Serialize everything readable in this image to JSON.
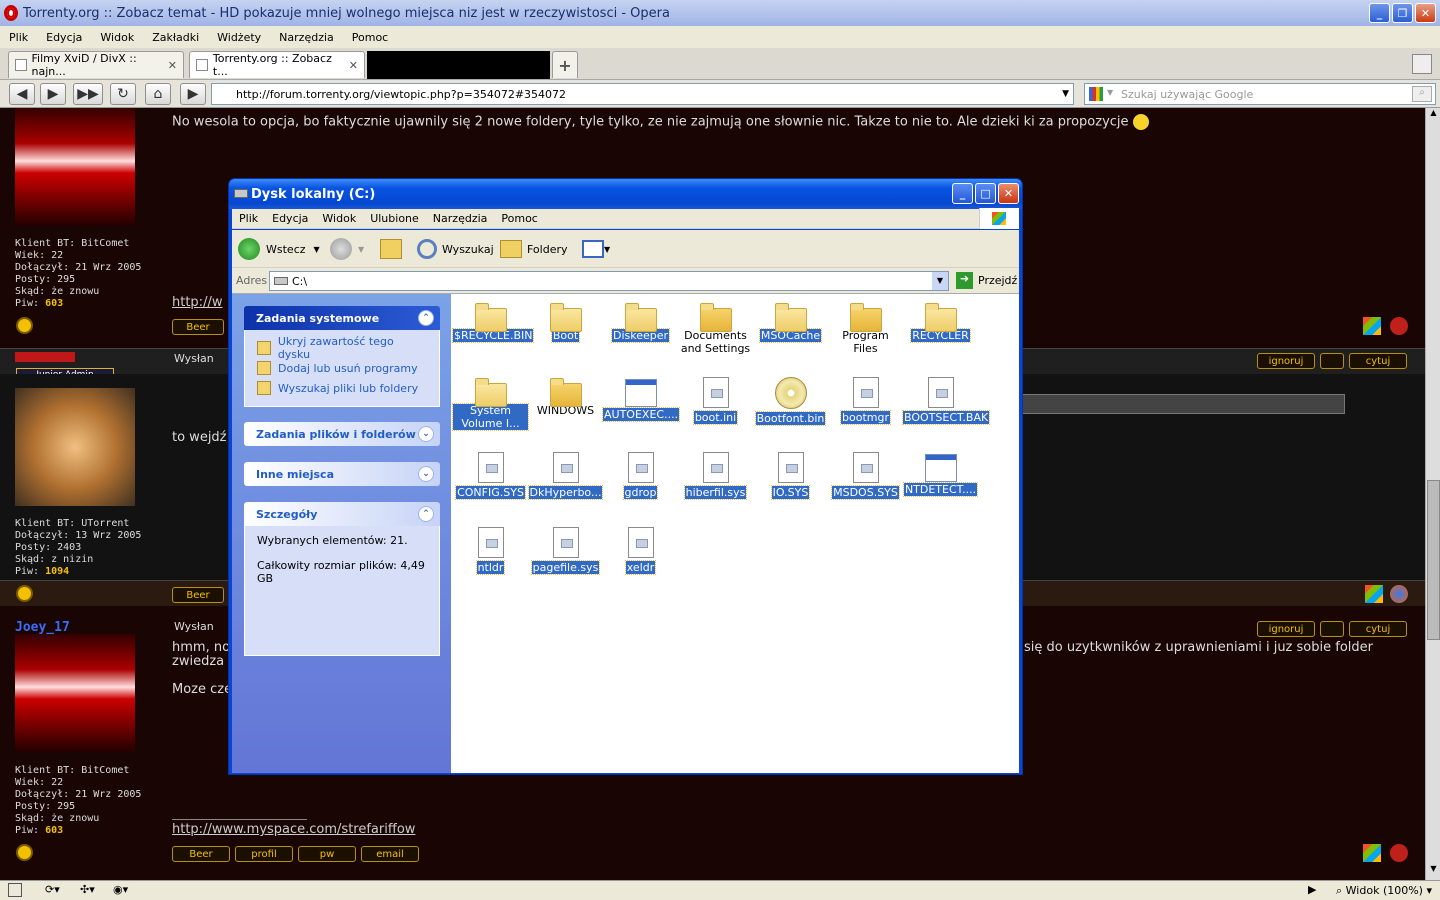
{
  "browser": {
    "title": "Torrenty.org :: Zobacz temat - HD pokazuje mniej wolnego miejsca niz jest w rzeczywistosci - Opera",
    "menu": [
      "Plik",
      "Edycja",
      "Widok",
      "Zakładki",
      "Widżety",
      "Narzędzia",
      "Pomoc"
    ],
    "tabs": [
      {
        "label": "Filmy XviD / DivX :: najn..."
      },
      {
        "label": "Torrenty.org :: Zobacz t..."
      }
    ],
    "url": "http://forum.torrenty.org/viewtopic.php?p=354072#354072",
    "search_placeholder": "Szukaj używając Google",
    "zoom": "Widok (100%)"
  },
  "forum": {
    "post1": {
      "text": "No wesola to opcja, bo faktycznie ujawnily się 2 nowe foldery, tyle tylko, ze nie zajmują one słownie nic. Takze to nie to. Ale dzieki ki za propozycje",
      "info": [
        "Klient BT: BitComet",
        "Wiek: 22",
        "Dołączył: 21 Wrz 2005",
        "Posty: 295",
        "Skąd: że znowu"
      ],
      "piw_label": "Piw:",
      "piw": "603",
      "link": "http://w",
      "beer": "Beer"
    },
    "post2": {
      "rank": "Junior Admin",
      "posted": "Wysłan",
      "text": "to wejdź",
      "info": [
        "Klient BT: UTorrent",
        "Dołączył: 13 Wrz 2005",
        "Posty: 2403",
        "Skąd: z nizin"
      ],
      "piw_label": "Piw:",
      "piw": "1094",
      "beer": "Beer",
      "ignore": "ignoruj",
      "quote": "cytuj"
    },
    "post3": {
      "username": "Joey_17",
      "posted": "Wysłan",
      "text1": "hmm, no",
      "text1b": "zwiedza",
      "text1_right": "się do uzytkwników z uprawnieniami i juz sobie folder",
      "text2": "Moze cze",
      "info": [
        "Klient BT: BitComet",
        "Wiek: 22",
        "Dołączył: 21 Wrz 2005",
        "Posty: 295",
        "Skąd: że znowu"
      ],
      "piw_label": "Piw:",
      "piw": "603",
      "link": "http://www.myspace.com/strefariffow",
      "buttons": [
        "Beer",
        "profil",
        "pw",
        "email"
      ],
      "ignore": "ignoruj",
      "quote": "cytuj"
    }
  },
  "explorer": {
    "title": "Dysk lokalny (C:)",
    "menu": [
      "Plik",
      "Edycja",
      "Widok",
      "Ulubione",
      "Narzędzia",
      "Pomoc"
    ],
    "toolbar": {
      "back": "Wstecz",
      "search": "Wyszukaj",
      "folders": "Foldery"
    },
    "address_label": "Adres",
    "address": "C:\\",
    "go": "Przejdź",
    "panels": {
      "system": {
        "title": "Zadania systemowe",
        "items": [
          "Ukryj zawartość tego dysku",
          "Dodaj lub usuń programy",
          "Wyszukaj pliki lub foldery"
        ]
      },
      "files": {
        "title": "Zadania plików i folderów"
      },
      "other": {
        "title": "Inne miejsca"
      },
      "details": {
        "title": "Szczegóły",
        "selected": "Wybranych elementów: 21.",
        "size": "Całkowity rozmiar plików: 4,49 GB"
      }
    },
    "files": [
      {
        "name": "$RECYCLE.BIN",
        "type": "folder",
        "sel": true
      },
      {
        "name": "Boot",
        "type": "folder",
        "sel": true
      },
      {
        "name": "Diskeeper",
        "type": "folder",
        "sel": true
      },
      {
        "name": "Documents and Settings",
        "type": "folder-dark",
        "sel": false
      },
      {
        "name": "MSOCache",
        "type": "folder",
        "sel": true
      },
      {
        "name": "Program Files",
        "type": "folder-dark",
        "sel": false
      },
      {
        "name": "RECYCLER",
        "type": "folder",
        "sel": true
      },
      {
        "name": "System Volume I...",
        "type": "folder",
        "sel": true
      },
      {
        "name": "WINDOWS",
        "type": "folder-dark",
        "sel": false
      },
      {
        "name": "AUTOEXEC....",
        "type": "win",
        "sel": true
      },
      {
        "name": "boot.ini",
        "type": "doc",
        "sel": true
      },
      {
        "name": "Bootfont.bin",
        "type": "cd",
        "sel": true
      },
      {
        "name": "bootmgr",
        "type": "doc",
        "sel": true
      },
      {
        "name": "BOOTSECT.BAK",
        "type": "doc",
        "sel": true
      },
      {
        "name": "CONFIG.SYS",
        "type": "doc",
        "sel": true
      },
      {
        "name": "DkHyperbo...",
        "type": "doc",
        "sel": true
      },
      {
        "name": "gdrop",
        "type": "doc",
        "sel": true
      },
      {
        "name": "hiberfil.sys",
        "type": "doc",
        "sel": true
      },
      {
        "name": "IO.SYS",
        "type": "doc",
        "sel": true
      },
      {
        "name": "MSDOS.SYS",
        "type": "doc",
        "sel": true
      },
      {
        "name": "NTDETECT....",
        "type": "win",
        "sel": true
      },
      {
        "name": "ntldr",
        "type": "doc",
        "sel": true
      },
      {
        "name": "pagefile.sys",
        "type": "doc",
        "sel": true
      },
      {
        "name": "xeldr",
        "type": "doc",
        "sel": true
      }
    ]
  }
}
